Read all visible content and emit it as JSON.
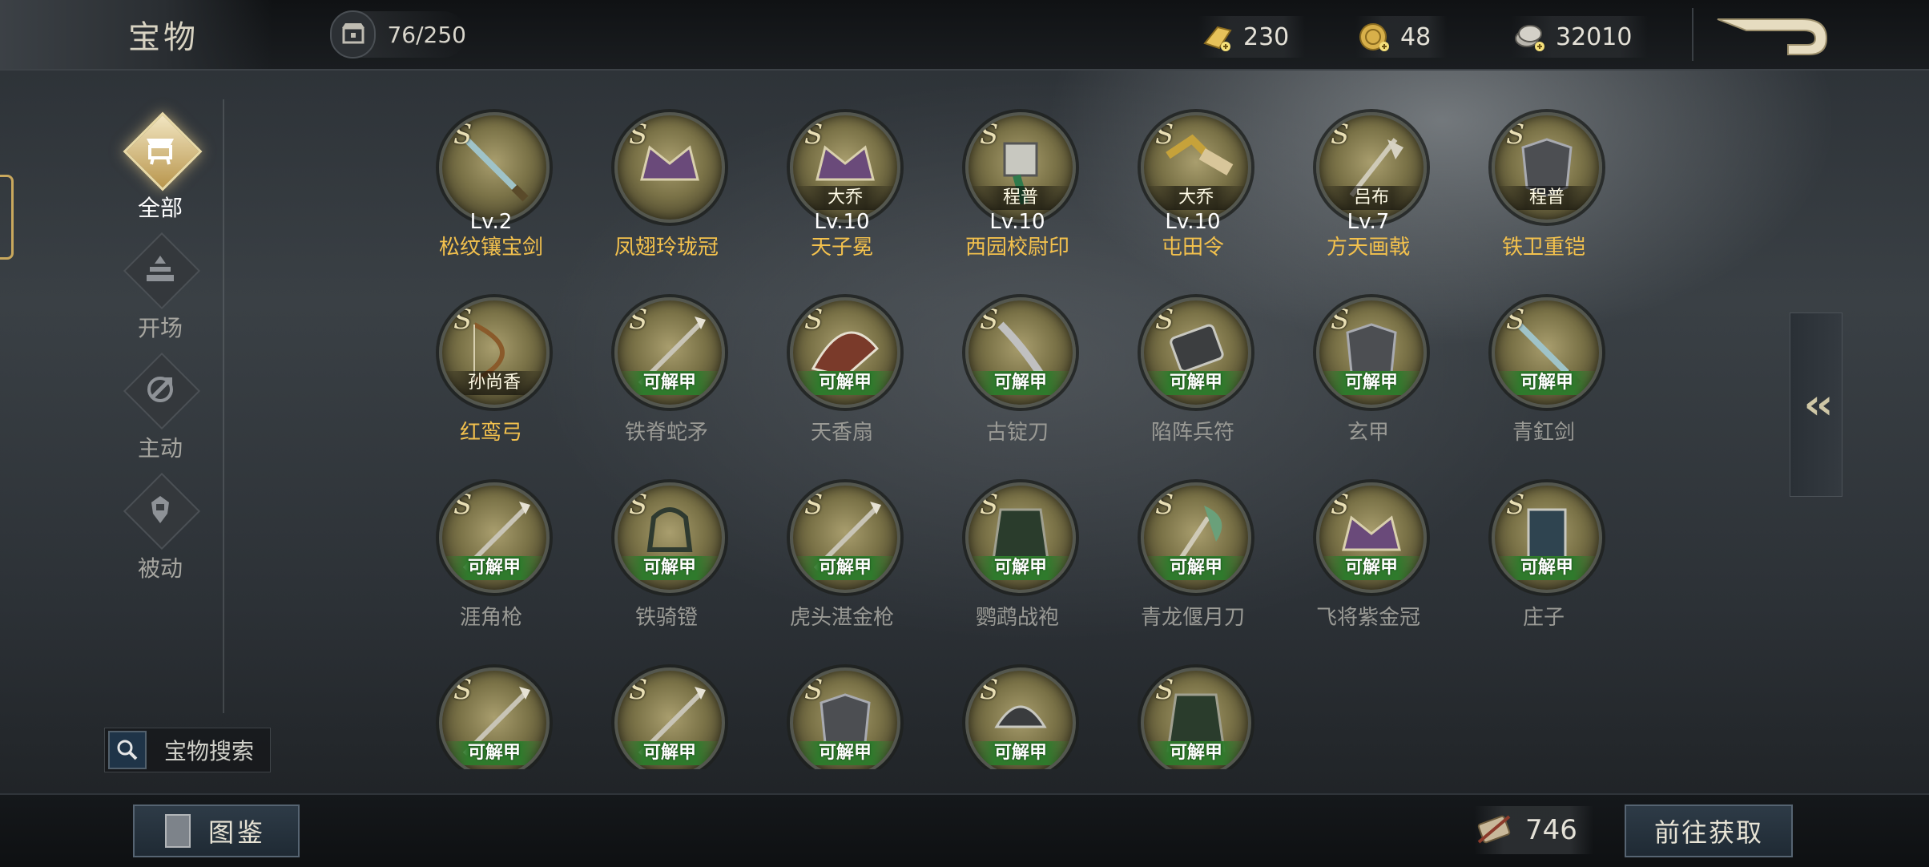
{
  "header": {
    "title": "宝物",
    "capacity": "76/250",
    "currencies": [
      {
        "icon": "gold-bar-icon",
        "value": "230"
      },
      {
        "icon": "gold-coin-icon",
        "value": "48"
      },
      {
        "icon": "silver-coin-icon",
        "value": "32010"
      }
    ]
  },
  "sidebar": {
    "tabs": [
      {
        "label": "全部",
        "icon": "all-treasures-icon",
        "active": true
      },
      {
        "label": "开场",
        "icon": "opening-icon",
        "active": false
      },
      {
        "label": "主动",
        "icon": "active-skill-icon",
        "active": false
      },
      {
        "label": "被动",
        "icon": "passive-skill-icon",
        "active": false
      }
    ],
    "search_label": "宝物搜索"
  },
  "items": [
    {
      "rank": "S",
      "level": "Lv.2",
      "name": "松纹镶宝剑",
      "band": "",
      "owned": true,
      "icon": "sword-icon"
    },
    {
      "rank": "S",
      "level": "",
      "name": "凤翅玲珑冠",
      "band": "",
      "owned": true,
      "icon": "crown-icon"
    },
    {
      "rank": "S",
      "level": "Lv.10",
      "name": "天子冕",
      "band": "大乔",
      "owned": true,
      "icon": "crown-icon"
    },
    {
      "rank": "S",
      "level": "Lv.10",
      "name": "西园校尉印",
      "band": "程普",
      "owned": true,
      "icon": "seal-icon"
    },
    {
      "rank": "S",
      "level": "Lv.10",
      "name": "屯田令",
      "band": "大乔",
      "owned": true,
      "icon": "scroll-icon"
    },
    {
      "rank": "S",
      "level": "Lv.7",
      "name": "方天画戟",
      "band": "吕布",
      "owned": true,
      "icon": "halberd-icon"
    },
    {
      "rank": "S",
      "level": "",
      "name": "铁卫重铠",
      "band": "程普",
      "owned": true,
      "icon": "armor-icon"
    },
    {
      "rank": "S",
      "level": "",
      "name": "红鸾弓",
      "band": "孙尚香",
      "owned": true,
      "icon": "bow-icon"
    },
    {
      "rank": "S",
      "level": "",
      "name": "铁脊蛇矛",
      "band": "可解甲",
      "owned": false,
      "icon": "spear-icon"
    },
    {
      "rank": "S",
      "level": "",
      "name": "天香扇",
      "band": "可解甲",
      "owned": false,
      "icon": "fan-icon"
    },
    {
      "rank": "S",
      "level": "",
      "name": "古锭刀",
      "band": "可解甲",
      "owned": false,
      "icon": "blade-icon"
    },
    {
      "rank": "S",
      "level": "",
      "name": "陷阵兵符",
      "band": "可解甲",
      "owned": false,
      "icon": "tally-icon"
    },
    {
      "rank": "S",
      "level": "",
      "name": "玄甲",
      "band": "可解甲",
      "owned": false,
      "icon": "armor-icon"
    },
    {
      "rank": "S",
      "level": "",
      "name": "青釭剑",
      "band": "可解甲",
      "owned": false,
      "icon": "sword-icon"
    },
    {
      "rank": "S",
      "level": "",
      "name": "涯角枪",
      "band": "可解甲",
      "owned": false,
      "icon": "spear-icon"
    },
    {
      "rank": "S",
      "level": "",
      "name": "铁骑镫",
      "band": "可解甲",
      "owned": false,
      "icon": "stirrup-icon"
    },
    {
      "rank": "S",
      "level": "",
      "name": "虎头湛金枪",
      "band": "可解甲",
      "owned": false,
      "icon": "spear-icon"
    },
    {
      "rank": "S",
      "level": "",
      "name": "鹦鹉战袍",
      "band": "可解甲",
      "owned": false,
      "icon": "robe-icon"
    },
    {
      "rank": "S",
      "level": "",
      "name": "青龙偃月刀",
      "band": "可解甲",
      "owned": false,
      "icon": "glaive-icon"
    },
    {
      "rank": "S",
      "level": "",
      "name": "飞将紫金冠",
      "band": "可解甲",
      "owned": false,
      "icon": "crown-icon"
    },
    {
      "rank": "S",
      "level": "",
      "name": "庄子",
      "band": "可解甲",
      "owned": false,
      "icon": "book-icon"
    },
    {
      "rank": "S",
      "level": "",
      "name": "",
      "band": "可解甲",
      "owned": false,
      "icon": "spear-icon"
    },
    {
      "rank": "S",
      "level": "",
      "name": "",
      "band": "可解甲",
      "owned": false,
      "icon": "spear-icon"
    },
    {
      "rank": "S",
      "level": "",
      "name": "",
      "band": "可解甲",
      "owned": false,
      "icon": "armor-icon"
    },
    {
      "rank": "S",
      "level": "",
      "name": "",
      "band": "可解甲",
      "owned": false,
      "icon": "helmet-icon"
    },
    {
      "rank": "S",
      "level": "",
      "name": "",
      "band": "可解甲",
      "owned": false,
      "icon": "robe-icon"
    }
  ],
  "footer": {
    "codex_label": "图鉴",
    "token_value": "746",
    "goto_label": "前往获取"
  },
  "colors": {
    "owned_name": "#f3c14d",
    "unowned_name": "#9a9a95",
    "dismantle_band": "#2f7a2c",
    "accent_gold": "#c9a85d"
  }
}
